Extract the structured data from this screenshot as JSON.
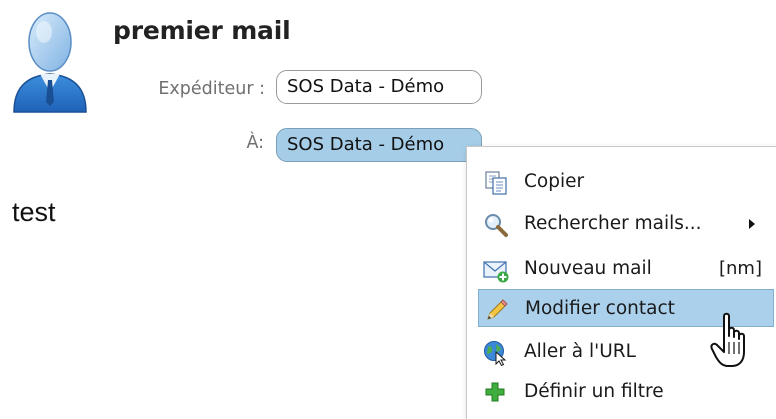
{
  "message": {
    "subject": "premier mail",
    "from_label": "Expéditeur :",
    "from_value": "SOS Data - Démo",
    "to_label": "À:",
    "to_value": "SOS Data - Démo",
    "body": "test"
  },
  "context_menu": {
    "items": [
      {
        "label": "Copier",
        "icon": "copy-icon"
      },
      {
        "label": "Rechercher mails...",
        "icon": "search-icon",
        "submenu": true
      },
      {
        "label": "Nouveau mail",
        "icon": "new-mail-icon",
        "shortcut": "[nm]"
      },
      {
        "label": "Modifier contact",
        "icon": "pencil-icon",
        "hovered": true
      },
      {
        "label": "Aller à l'URL",
        "icon": "globe-link-icon"
      },
      {
        "label": "Définir un filtre",
        "icon": "plus-icon"
      }
    ]
  },
  "colors": {
    "chip_selected": "#a5cde8",
    "menu_hover": "#aad0ec",
    "label_gray": "#707070"
  },
  "cursor": "hand-pointer-icon"
}
